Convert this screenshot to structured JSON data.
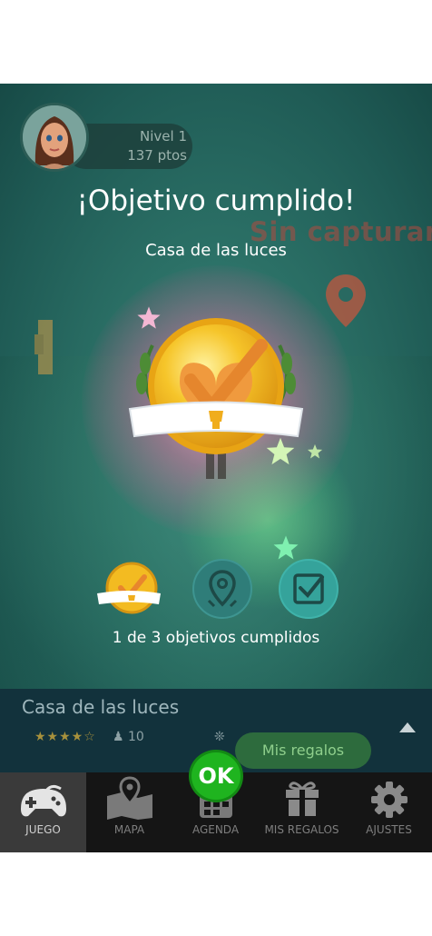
{
  "header": {
    "level_label": "Nivel 1",
    "points_label": "137 ptos"
  },
  "title": "¡Objetivo cumplido!",
  "subtitle": "Casa de las luces",
  "scene": {
    "background_sign": "Sin capturar"
  },
  "objectives": {
    "completed": 1,
    "total": 3,
    "progress_text": "1 de 3 objetivos cumplidos",
    "icons": [
      "gold-medal-icon",
      "location-pin-icon",
      "checkbox-icon"
    ]
  },
  "location_panel": {
    "name": "Casa de las luces",
    "rating": 4,
    "rating_max": 5,
    "rating_stars": "★★★★☆",
    "players_count": "10"
  },
  "gifts_bubble": "Mis regalos",
  "ok_button": "OK",
  "nav": [
    {
      "label": "JUEGO",
      "icon": "gamepad-icon",
      "active": true
    },
    {
      "label": "MAPA",
      "icon": "map-icon",
      "active": false
    },
    {
      "label": "AGENDA",
      "icon": "agenda-icon",
      "active": false
    },
    {
      "label": "MIS REGALOS",
      "icon": "gift-icon",
      "active": false
    },
    {
      "label": "AJUSTES",
      "icon": "gear-icon",
      "active": false
    }
  ],
  "colors": {
    "scene_teal": "#2b7066",
    "medal_gold": "#f2b51e",
    "ok_green": "#1fb41f",
    "nav_bg": "#151515",
    "panel_bg": "#12323c"
  }
}
